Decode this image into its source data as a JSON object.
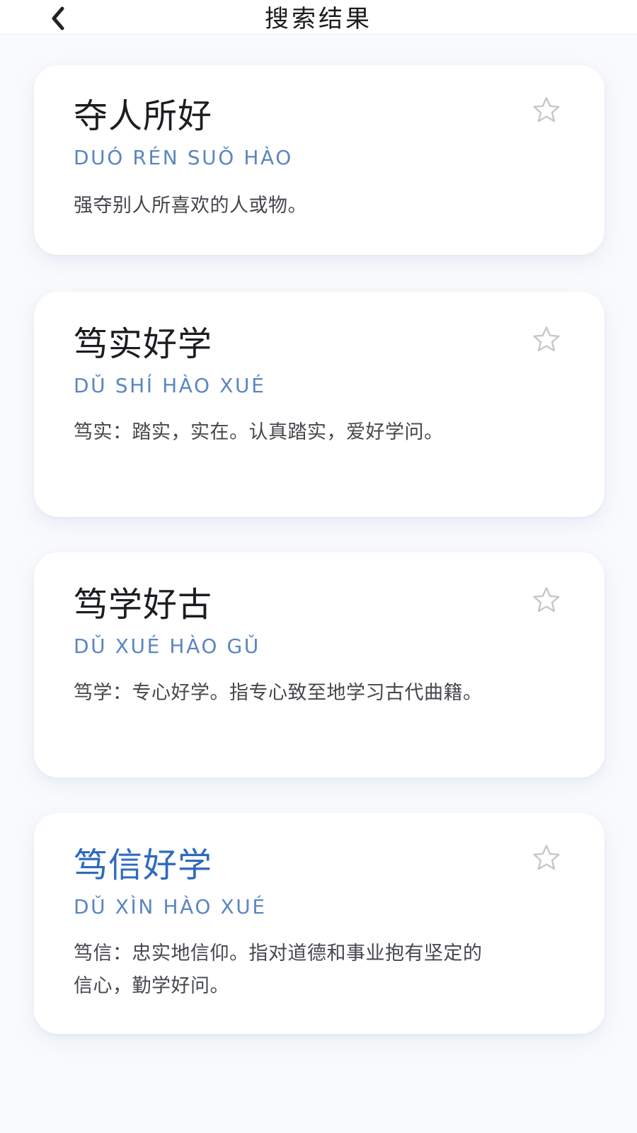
{
  "header": {
    "title": "搜索结果"
  },
  "results": [
    {
      "word": "夺人所好",
      "pinyin": "DUÓ RÉN SUǑ HÀO",
      "meaning": "强夺别人所喜欢的人或物。"
    },
    {
      "word": "笃实好学",
      "pinyin": "DǓ SHÍ HÀO XUÉ",
      "meaning": "笃实：踏实，实在。认真踏实，爱好学问。"
    },
    {
      "word": "笃学好古",
      "pinyin": "DǓ XUÉ HÀO GǓ",
      "meaning": "笃学：专心好学。指专心致至地学习古代曲籍。"
    },
    {
      "word": "笃信好学",
      "pinyin": "DǓ XÌN HÀO XUÉ",
      "meaning": "笃信：忠实地信仰。指对道德和事业抱有坚定的信心，勤学好问。"
    }
  ],
  "colors": {
    "word": "#1b1d21",
    "word_highlight": "#2f6bbd",
    "pinyin": "#5b86c0",
    "meaning": "#44474c",
    "star_outline": "#c4c7cc"
  },
  "icons": {
    "back": "chevron-left-icon",
    "favorite": "star-outline-icon"
  }
}
